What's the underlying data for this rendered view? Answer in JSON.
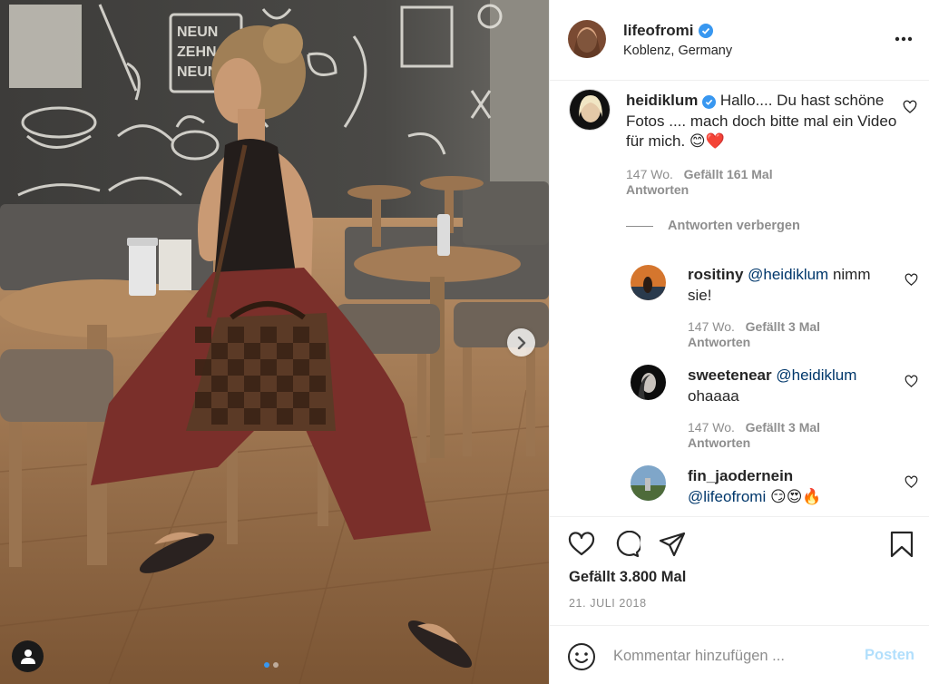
{
  "post": {
    "author": "lifeofromi",
    "location": "Koblenz, Germany",
    "verified": true,
    "more_icon": "more-horizontal-icon",
    "carousel": {
      "slides": 2,
      "current": 1
    }
  },
  "comments": [
    {
      "user": "heidiklum",
      "verified": true,
      "text": "Hallo.... Du hast schöne Fotos .... mach doch bitte mal ein Video für mich. 😊❤️",
      "age": "147 Wo.",
      "likes": "Gefällt 161 Mal",
      "reply": "Antworten"
    }
  ],
  "hide_replies": "Antworten verbergen",
  "replies": [
    {
      "user": "rositiny",
      "mention": "@heidiklum",
      "text": "nimm sie!",
      "age": "147 Wo.",
      "likes": "Gefällt 3 Mal",
      "reply": "Antworten"
    },
    {
      "user": "sweetenear",
      "mention": "@heidiklum",
      "text": "ohaaaa",
      "age": "147 Wo.",
      "likes": "Gefällt 3 Mal",
      "reply": "Antworten"
    },
    {
      "user": "fin_jaodernein",
      "mention": "@lifeofromi",
      "text": "😏😍🔥"
    }
  ],
  "actions": {
    "likes": "Gefällt 3.800 Mal",
    "date": "21. JULI 2018",
    "icons": [
      "heart-icon",
      "comment-icon",
      "share-icon",
      "bookmark-icon"
    ]
  },
  "add_comment": {
    "placeholder": "Kommentar hinzufügen ...",
    "post_label": "Posten"
  },
  "colors": {
    "accent": "#3897f0",
    "text": "#262626",
    "muted": "#8e8e8e",
    "mention": "#00376b",
    "post_disabled": "#b2dffc",
    "heart": "#ed4956"
  }
}
